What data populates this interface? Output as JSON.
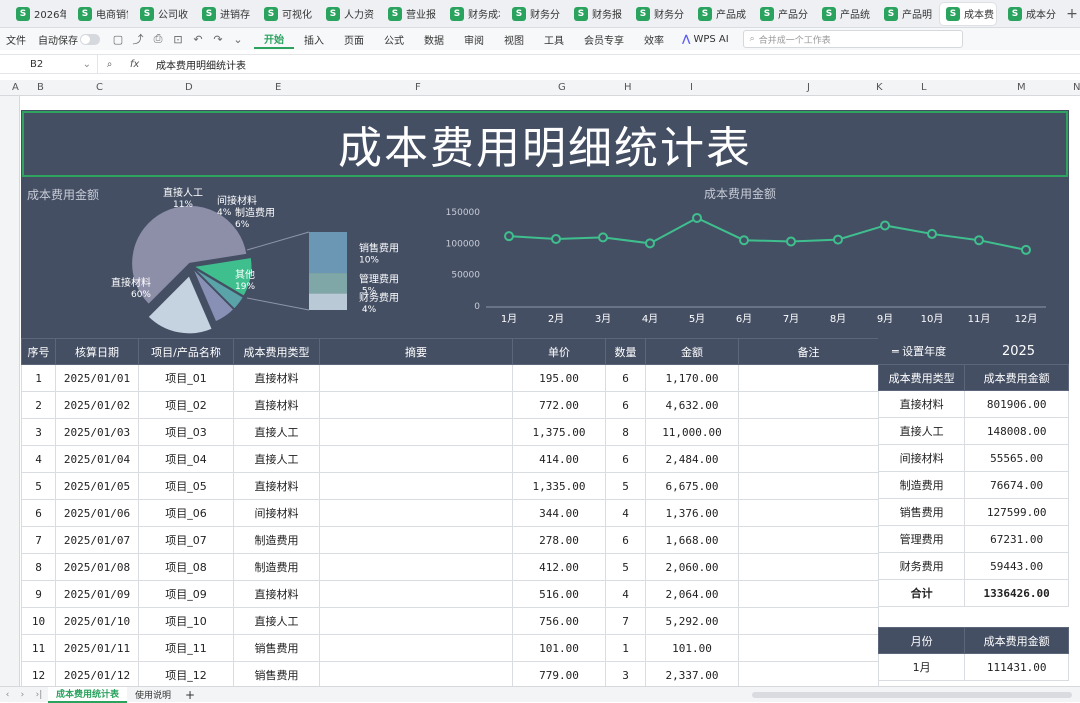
{
  "tabs": [
    {
      "label": "2026年",
      "active": false
    },
    {
      "label": "电商销售",
      "active": false
    },
    {
      "label": "公司收",
      "active": false
    },
    {
      "label": "进销存",
      "active": false
    },
    {
      "label": "可视化",
      "active": false
    },
    {
      "label": "人力资",
      "active": false
    },
    {
      "label": "营业报",
      "active": false
    },
    {
      "label": "财务成本",
      "active": false
    },
    {
      "label": "财务分",
      "active": false
    },
    {
      "label": "财务报",
      "active": false
    },
    {
      "label": "财务分",
      "active": false
    },
    {
      "label": "产品成",
      "active": false
    },
    {
      "label": "产品分",
      "active": false
    },
    {
      "label": "产品统",
      "active": false
    },
    {
      "label": "产品明",
      "active": false
    },
    {
      "label": "成本费",
      "active": true
    },
    {
      "label": "成本分",
      "active": false
    }
  ],
  "ribbon": {
    "file": "文件",
    "autosave": "自动保存",
    "menus": [
      "开始",
      "插入",
      "页面",
      "公式",
      "数据",
      "审阅",
      "视图",
      "工具",
      "会员专享",
      "效率"
    ],
    "active_menu": "开始",
    "wps_ai": "WPS AI",
    "search_placeholder": "合并成一个工作表"
  },
  "formula_bar": {
    "cell_ref": "B2",
    "content": "成本费用明细统计表"
  },
  "columns": [
    "A",
    "B",
    "C",
    "D",
    "E",
    "F",
    "G",
    "H",
    "I",
    "J",
    "K",
    "L",
    "M",
    "N"
  ],
  "dashboard": {
    "title": "成本费用明细统计表",
    "pie_title": "成本费用金额",
    "line_title": "成本费用金额"
  },
  "chart_data": [
    {
      "type": "pie",
      "title": "成本费用金额",
      "slices": [
        {
          "label": "直接材料",
          "percent": "60%",
          "value": 60,
          "color": "#8d8ea8"
        },
        {
          "label": "直接人工",
          "percent": "11%",
          "value": 11,
          "color": "#3fbf8e"
        },
        {
          "label": "间接材料",
          "percent": "4%",
          "value": 4,
          "color": "#5aa3a8"
        },
        {
          "label": "制造费用",
          "percent": "6%",
          "value": 6,
          "color": "#8890b6"
        },
        {
          "label": "其他",
          "percent": "19%",
          "value": 19,
          "color": "#c4d3df"
        }
      ],
      "breakdown": [
        {
          "label": "销售费用",
          "percent": "10%",
          "value": 10,
          "color": "#6b96b4"
        },
        {
          "label": "管理费用",
          "percent": "5%",
          "value": 5,
          "color": "#7fa7a8"
        },
        {
          "label": "财务费用",
          "percent": "4%",
          "value": 4,
          "color": "#bac9d6"
        }
      ]
    },
    {
      "type": "line",
      "title": "成本费用金额",
      "categories": [
        "1月",
        "2月",
        "3月",
        "4月",
        "5月",
        "6月",
        "7月",
        "8月",
        "9月",
        "10月",
        "11月",
        "12月"
      ],
      "values": [
        111431,
        107000,
        109500,
        100000,
        140500,
        105000,
        103000,
        106000,
        128500,
        115000,
        105000,
        89500
      ],
      "yticks": [
        "0",
        "50000",
        "100000",
        "150000"
      ],
      "ylim": [
        0,
        150000
      ],
      "color": "#3fbf8e"
    }
  ],
  "table": {
    "headers": [
      "序号",
      "核算日期",
      "项目/产品名称",
      "成本费用类型",
      "摘要",
      "单价",
      "数量",
      "金额",
      "备注"
    ],
    "rows": [
      [
        "1",
        "2025/01/01",
        "项目_01",
        "直接材料",
        "",
        "195.00",
        "6",
        "1,170.00",
        ""
      ],
      [
        "2",
        "2025/01/02",
        "项目_02",
        "直接材料",
        "",
        "772.00",
        "6",
        "4,632.00",
        ""
      ],
      [
        "3",
        "2025/01/03",
        "项目_03",
        "直接人工",
        "",
        "1,375.00",
        "8",
        "11,000.00",
        ""
      ],
      [
        "4",
        "2025/01/04",
        "项目_04",
        "直接人工",
        "",
        "414.00",
        "6",
        "2,484.00",
        ""
      ],
      [
        "5",
        "2025/01/05",
        "项目_05",
        "直接材料",
        "",
        "1,335.00",
        "5",
        "6,675.00",
        ""
      ],
      [
        "6",
        "2025/01/06",
        "项目_06",
        "间接材料",
        "",
        "344.00",
        "4",
        "1,376.00",
        ""
      ],
      [
        "7",
        "2025/01/07",
        "项目_07",
        "制造费用",
        "",
        "278.00",
        "6",
        "1,668.00",
        ""
      ],
      [
        "8",
        "2025/01/08",
        "项目_08",
        "制造费用",
        "",
        "412.00",
        "5",
        "2,060.00",
        ""
      ],
      [
        "9",
        "2025/01/09",
        "项目_09",
        "直接材料",
        "",
        "516.00",
        "4",
        "2,064.00",
        ""
      ],
      [
        "10",
        "2025/01/10",
        "项目_10",
        "直接人工",
        "",
        "756.00",
        "7",
        "5,292.00",
        ""
      ],
      [
        "11",
        "2025/01/11",
        "项目_11",
        "销售费用",
        "",
        "101.00",
        "1",
        "101.00",
        ""
      ],
      [
        "12",
        "2025/01/12",
        "项目_12",
        "销售费用",
        "",
        "779.00",
        "3",
        "2,337.00",
        ""
      ]
    ]
  },
  "side": {
    "year_label": "设置年度",
    "year_value": "2025",
    "type_headers": [
      "成本费用类型",
      "成本费用金额"
    ],
    "type_rows": [
      [
        "直接材料",
        "801906.00"
      ],
      [
        "直接人工",
        "148008.00"
      ],
      [
        "间接材料",
        "55565.00"
      ],
      [
        "制造费用",
        "76674.00"
      ],
      [
        "销售费用",
        "127599.00"
      ],
      [
        "管理费用",
        "67231.00"
      ],
      [
        "财务费用",
        "59443.00"
      ]
    ],
    "total_label": "合计",
    "total_value": "1336426.00",
    "month_headers": [
      "月份",
      "成本费用金额"
    ],
    "month_rows": [
      [
        "1月",
        "111431.00"
      ]
    ]
  },
  "sheets": [
    {
      "label": "成本费用统计表",
      "active": true
    },
    {
      "label": "使用说明",
      "active": false
    }
  ]
}
